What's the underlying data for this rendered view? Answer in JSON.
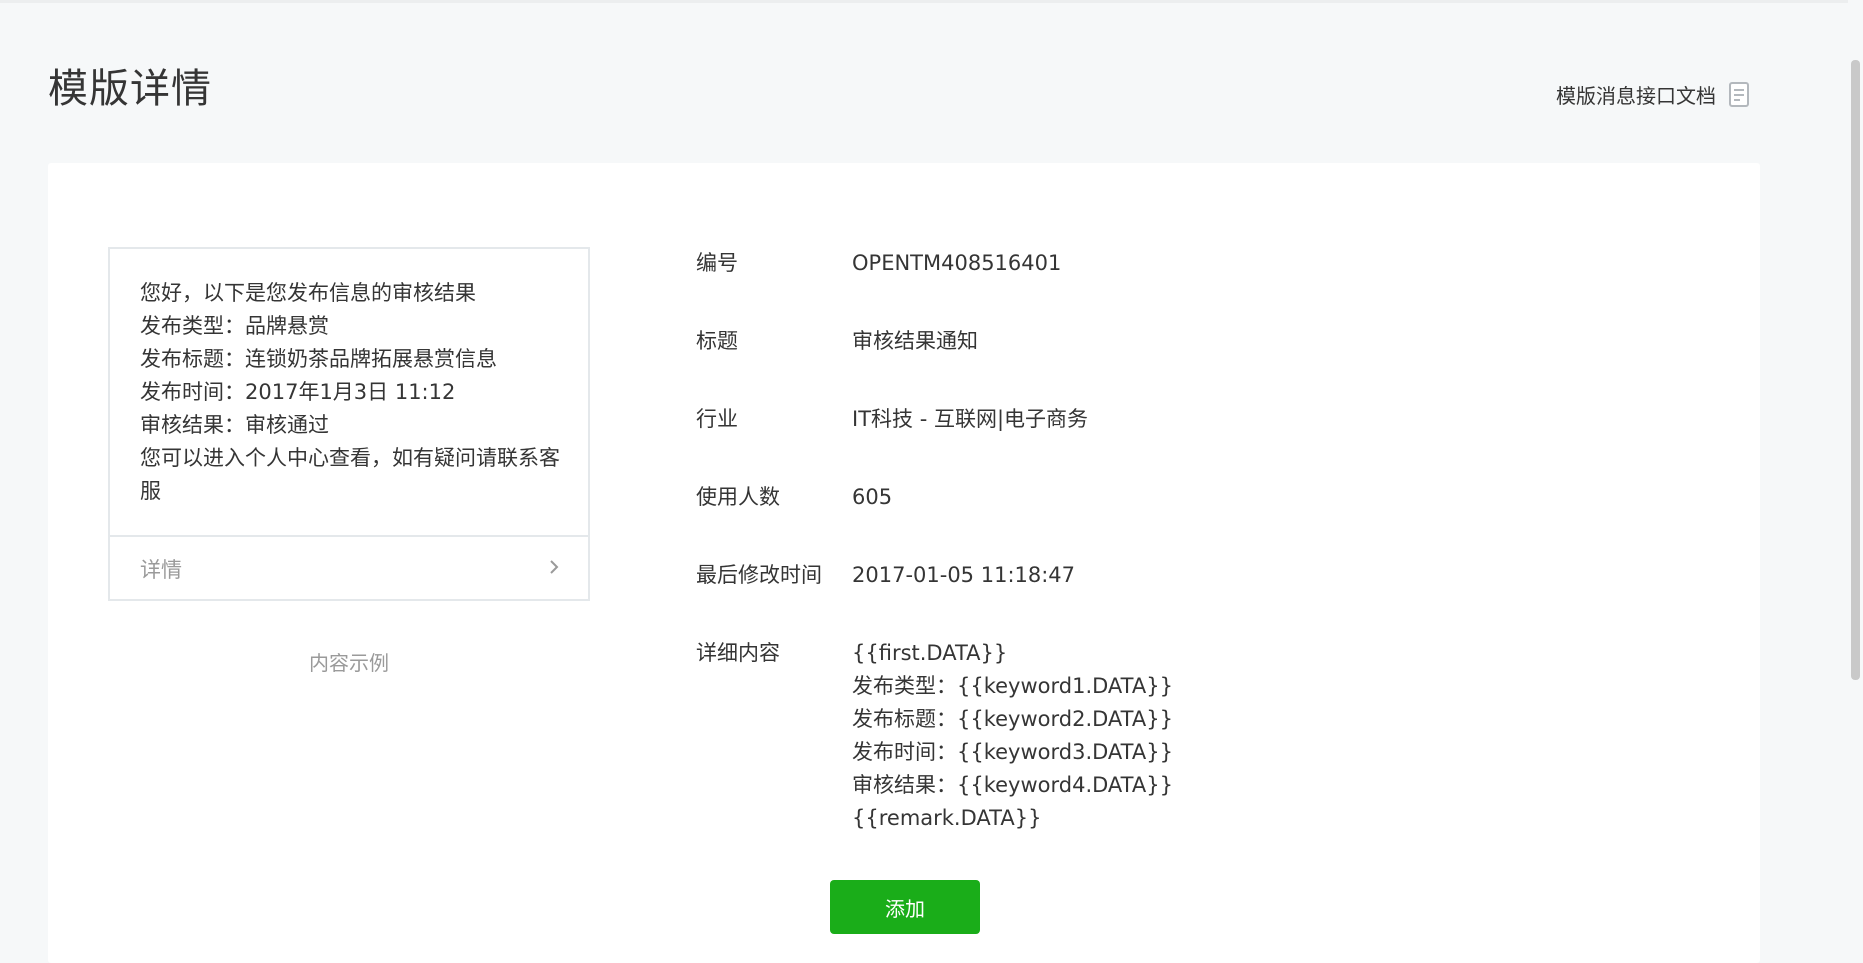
{
  "page": {
    "title": "模版详情",
    "doc_link_label": "模版消息接口文档",
    "doc_icon": "document-icon"
  },
  "preview": {
    "lines": [
      "您好，以下是您发布信息的审核结果",
      "发布类型：品牌悬赏",
      "发布标题：连锁奶茶品牌拓展悬赏信息",
      "发布时间：2017年1月3日 11:12",
      "审核结果：审核通过",
      "您可以进入个人中心查看，如有疑问请联系客服"
    ],
    "footer_label": "详情",
    "footer_icon": "chevron-right-icon",
    "caption": "内容示例"
  },
  "info": {
    "number_label": "编号",
    "number_value": "OPENTM408516401",
    "title_label": "标题",
    "title_value": "审核结果通知",
    "industry_label": "行业",
    "industry_value": "IT科技 - 互联网|电子商务",
    "users_label": "使用人数",
    "users_value": "605",
    "modified_label": "最后修改时间",
    "modified_value": "2017-01-05 11:18:47",
    "content_label": "详细内容",
    "content_lines": [
      "{{first.DATA}}",
      "发布类型：{{keyword1.DATA}}",
      "发布标题：{{keyword2.DATA}}",
      "发布时间：{{keyword3.DATA}}",
      "审核结果：{{keyword4.DATA}}",
      "{{remark.DATA}}"
    ]
  },
  "actions": {
    "add_label": "添加"
  },
  "colors": {
    "primary_green": "#1aad19",
    "background": "#f6f8f9",
    "muted_text": "#9a9a9a"
  }
}
